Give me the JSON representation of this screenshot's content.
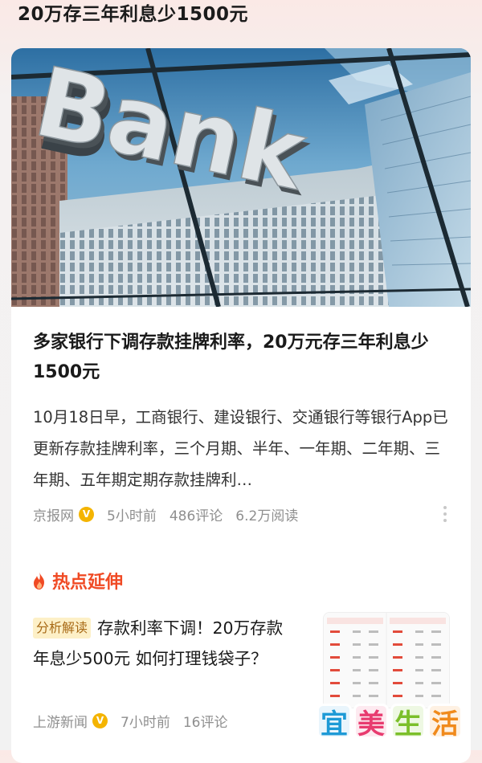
{
  "topic_title": "20万存三年利息少1500元",
  "article": {
    "hero_sign_text": "Bank",
    "headline": "多家银行下调存款挂牌利率，20万元存三年利息少1500元",
    "summary": "10月18日早，工商银行、建设银行、交通银行等银行App已更新存款挂牌利率，三个月期、半年、一年期、二年期、三年期、五年期定期存款挂牌利…",
    "source": "京报网",
    "verified_badge": "V",
    "time": "5小时前",
    "comments": "486评论",
    "reads": "6.2万阅读",
    "more_icon": "more-vertical-icon"
  },
  "hot_section": {
    "title": "热点延伸",
    "icon": "flame-icon",
    "icon_color": "#f04a24"
  },
  "related": {
    "tag": "分析解读",
    "title": "存款利率下调！20万存款年息少500元 如何打理钱袋子？",
    "source": "上游新闻",
    "verified_badge": "V",
    "time": "7小时前",
    "comments": "16评论"
  },
  "watermark": {
    "chars": [
      "宜",
      "美",
      "生",
      "活"
    ],
    "colors": [
      "#1e9ad6",
      "#e83b6f",
      "#7bbf2a",
      "#f08a1c"
    ]
  }
}
